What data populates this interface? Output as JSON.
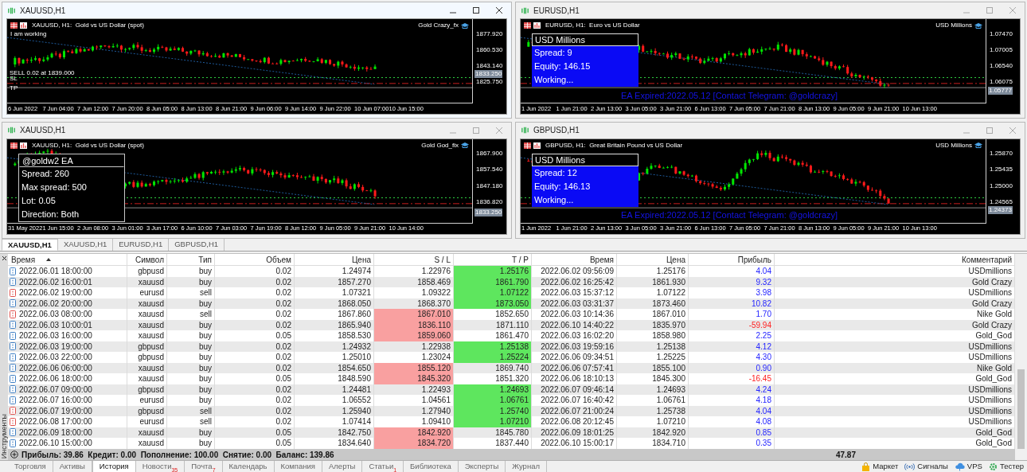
{
  "charts": [
    {
      "title": "XAUUSD,H1",
      "active": true,
      "header": "XAUUSD, H1:  Gold vs US Dollar (spot)",
      "ea_name": "Gold Crazy_fx",
      "status": "I am working",
      "price_labels": [
        "1877.920",
        "1860.530",
        "1843.140",
        "1825.750"
      ],
      "current_price": "1833.250",
      "time_labels": [
        "6 Jun 2022",
        "7 Jun 04:00",
        "7 Jun 12:00",
        "7 Jun 20:00",
        "8 Jun 05:00",
        "8 Jun 13:00",
        "8 Jun 21:00",
        "9 Jun 06:00",
        "9 Jun 14:00",
        "9 Jun 22:00",
        "10 Jun 07:00",
        "10 Jun 15:00"
      ],
      "level_labels": [
        "SELL 0.02 at 1839.000",
        "SL",
        "TP"
      ]
    },
    {
      "title": "EURUSD,H1",
      "active": false,
      "header": "EURUSD, H1:  Euro vs US Dollar",
      "ea_name": "USD Millions",
      "price_labels": [
        "1.07470",
        "1.07005",
        "1.06540",
        "1.06075"
      ],
      "current_price": "1.05777",
      "time_labels": [
        "1 Jun 2022",
        "1 Jun 21:00",
        "2 Jun 13:00",
        "3 Jun 05:00",
        "3 Jun 21:00",
        "6 Jun 13:00",
        "7 Jun 05:00",
        "7 Jun 21:00",
        "8 Jun 13:00",
        "9 Jun 05:00",
        "9 Jun 21:00",
        "10 Jun 13:00"
      ],
      "panel": {
        "kind": "blue",
        "title": "USD Millions",
        "lines": [
          "Spread: 9",
          "Equity: 146.15",
          "Working..."
        ]
      },
      "expired": "EA Expired:2022.05.12 [Contact Telegram: @goldcrazy]"
    },
    {
      "title": "XAUUSD,H1",
      "active": false,
      "header": "XAUUSD, H1:  Gold vs US Dollar (spot)",
      "ea_name": "Gold God_fix",
      "price_labels": [
        "1867.900",
        "1857.540",
        "1847.180",
        "1836.820"
      ],
      "current_price": "1833.250",
      "time_labels": [
        "31 May 2022",
        "1 Jun 15:00",
        "2 Jun 08:00",
        "3 Jun 01:00",
        "3 Jun 17:00",
        "6 Jun 10:00",
        "7 Jun 03:00",
        "7 Jun 19:00",
        "8 Jun 12:00",
        "9 Jun 05:00",
        "9 Jun 21:00",
        "10 Jun 14:00"
      ],
      "panel": {
        "kind": "dark",
        "title": "@goldw2 EA",
        "lines": [
          "Spread: 260",
          "Max spread: 500",
          "Lot: 0.05",
          "Direction: Both"
        ]
      }
    },
    {
      "title": "GBPUSD,H1",
      "active": false,
      "header": "GBPUSD, H1:  Great Britain Pound vs US Dollar",
      "ea_name": "USD Millions",
      "price_labels": [
        "1.25870",
        "1.25435",
        "1.25000",
        "1.24565"
      ],
      "current_price": "1.24373",
      "time_labels": [
        "1 Jun 2022",
        "1 Jun 21:00",
        "2 Jun 13:00",
        "3 Jun 05:00",
        "3 Jun 21:00",
        "6 Jun 13:00",
        "7 Jun 05:00",
        "7 Jun 21:00",
        "8 Jun 13:00",
        "9 Jun 05:00",
        "9 Jun 21:00",
        "10 Jun 13:00"
      ],
      "panel": {
        "kind": "blue",
        "title": "USD Millions",
        "lines": [
          "Spread: 12",
          "Equity: 146.13",
          "Working..."
        ]
      },
      "expired": "EA Expired:2022.05.12 [Contact Telegram: @goldcrazy]"
    }
  ],
  "chart_tabs": [
    {
      "label": "XAUUSD,H1",
      "selected": true
    },
    {
      "label": "XAUUSD,H1",
      "selected": false
    },
    {
      "label": "EURUSD,H1",
      "selected": false
    },
    {
      "label": "GBPUSD,H1",
      "selected": false
    }
  ],
  "toolbox_label": "Инструменты",
  "table": {
    "columns": [
      {
        "label": "Время",
        "sorted": true
      },
      {
        "label": "Символ",
        "sorted": false
      },
      {
        "label": "Тип",
        "sorted": false
      },
      {
        "label": "Объем",
        "sorted": false
      },
      {
        "label": "Цена",
        "sorted": false
      },
      {
        "label": "S / L",
        "sorted": false
      },
      {
        "label": "T / P",
        "sorted": false
      },
      {
        "label": "Время",
        "sorted": false
      },
      {
        "label": "Цена",
        "sorted": false
      },
      {
        "label": "Прибыль",
        "sorted": false
      },
      {
        "label": "Комментарий",
        "sorted": false
      }
    ],
    "rows": [
      {
        "open_time": "2022.06.01 18:00:00",
        "symbol": "gbpusd",
        "type": "buy",
        "volume": "0.02",
        "price": "1.24974",
        "sl": "1.22976",
        "tp": "1.25176",
        "close_time": "2022.06.02 09:56:09",
        "close_price": "1.25176",
        "profit": "4.04",
        "comment": "USDmillions",
        "sl_hit": false,
        "tp_hit": true,
        "color": "#3f7fc4",
        "loss": false
      },
      {
        "open_time": "2022.06.02 16:00:01",
        "symbol": "xauusd",
        "type": "buy",
        "volume": "0.02",
        "price": "1857.270",
        "sl": "1858.469",
        "tp": "1861.790",
        "close_time": "2022.06.02 16:25:42",
        "close_price": "1861.930",
        "profit": "9.32",
        "comment": "Gold Crazy",
        "sl_hit": false,
        "tp_hit": true,
        "color": "#3f7fc4",
        "loss": false
      },
      {
        "open_time": "2022.06.02 19:00:00",
        "symbol": "eurusd",
        "type": "sell",
        "volume": "0.02",
        "price": "1.07321",
        "sl": "1.09322",
        "tp": "1.07122",
        "close_time": "2022.06.03 15:37:12",
        "close_price": "1.07122",
        "profit": "3.98",
        "comment": "USDmillions",
        "sl_hit": false,
        "tp_hit": true,
        "color": "#e0504c",
        "loss": false
      },
      {
        "open_time": "2022.06.02 20:00:00",
        "symbol": "xauusd",
        "type": "buy",
        "volume": "0.02",
        "price": "1868.050",
        "sl": "1868.370",
        "tp": "1873.050",
        "close_time": "2022.06.03 03:31:37",
        "close_price": "1873.460",
        "profit": "10.82",
        "comment": "Gold Crazy",
        "sl_hit": false,
        "tp_hit": true,
        "color": "#3f7fc4",
        "loss": false
      },
      {
        "open_time": "2022.06.03 08:00:00",
        "symbol": "xauusd",
        "type": "sell",
        "volume": "0.02",
        "price": "1867.860",
        "sl": "1867.010",
        "tp": "1852.650",
        "close_time": "2022.06.03 10:14:36",
        "close_price": "1867.010",
        "profit": "1.70",
        "comment": "Nike Gold",
        "sl_hit": true,
        "tp_hit": false,
        "color": "#e0504c",
        "loss": false
      },
      {
        "open_time": "2022.06.03 10:00:01",
        "symbol": "xauusd",
        "type": "buy",
        "volume": "0.02",
        "price": "1865.940",
        "sl": "1836.110",
        "tp": "1871.110",
        "close_time": "2022.06.10 14:40:22",
        "close_price": "1835.970",
        "profit": "-59.94",
        "comment": "Gold Crazy",
        "sl_hit": true,
        "tp_hit": false,
        "color": "#3f7fc4",
        "loss": true
      },
      {
        "open_time": "2022.06.03 16:00:00",
        "symbol": "xauusd",
        "type": "buy",
        "volume": "0.05",
        "price": "1858.530",
        "sl": "1859.060",
        "tp": "1861.470",
        "close_time": "2022.06.03 16:02:20",
        "close_price": "1858.980",
        "profit": "2.25",
        "comment": "Gold_God",
        "sl_hit": true,
        "tp_hit": false,
        "color": "#3f7fc4",
        "loss": false
      },
      {
        "open_time": "2022.06.03 19:00:00",
        "symbol": "gbpusd",
        "type": "buy",
        "volume": "0.02",
        "price": "1.24932",
        "sl": "1.22938",
        "tp": "1.25138",
        "close_time": "2022.06.03 19:59:16",
        "close_price": "1.25138",
        "profit": "4.12",
        "comment": "USDmillions",
        "sl_hit": false,
        "tp_hit": true,
        "color": "#3f7fc4",
        "loss": false
      },
      {
        "open_time": "2022.06.03 22:00:00",
        "symbol": "gbpusd",
        "type": "buy",
        "volume": "0.02",
        "price": "1.25010",
        "sl": "1.23024",
        "tp": "1.25224",
        "close_time": "2022.06.06 09:34:51",
        "close_price": "1.25225",
        "profit": "4.30",
        "comment": "USDmillions",
        "sl_hit": false,
        "tp_hit": true,
        "color": "#3f7fc4",
        "loss": false
      },
      {
        "open_time": "2022.06.06 06:00:00",
        "symbol": "xauusd",
        "type": "buy",
        "volume": "0.02",
        "price": "1854.650",
        "sl": "1855.120",
        "tp": "1869.740",
        "close_time": "2022.06.06 07:57:41",
        "close_price": "1855.100",
        "profit": "0.90",
        "comment": "Nike Gold",
        "sl_hit": true,
        "tp_hit": false,
        "color": "#3f7fc4",
        "loss": false
      },
      {
        "open_time": "2022.06.06 18:00:00",
        "symbol": "xauusd",
        "type": "buy",
        "volume": "0.05",
        "price": "1848.590",
        "sl": "1845.320",
        "tp": "1851.320",
        "close_time": "2022.06.06 18:10:13",
        "close_price": "1845.300",
        "profit": "-16.45",
        "comment": "Gold_God",
        "sl_hit": true,
        "tp_hit": false,
        "color": "#3f7fc4",
        "loss": true
      },
      {
        "open_time": "2022.06.07 09:00:00",
        "symbol": "gbpusd",
        "type": "buy",
        "volume": "0.02",
        "price": "1.24481",
        "sl": "1.22493",
        "tp": "1.24693",
        "close_time": "2022.06.07 09:46:14",
        "close_price": "1.24693",
        "profit": "4.24",
        "comment": "USDmillions",
        "sl_hit": false,
        "tp_hit": true,
        "color": "#3f7fc4",
        "loss": false
      },
      {
        "open_time": "2022.06.07 16:00:00",
        "symbol": "eurusd",
        "type": "buy",
        "volume": "0.02",
        "price": "1.06552",
        "sl": "1.04561",
        "tp": "1.06761",
        "close_time": "2022.06.07 16:40:42",
        "close_price": "1.06761",
        "profit": "4.18",
        "comment": "USDmillions",
        "sl_hit": false,
        "tp_hit": true,
        "color": "#3f7fc4",
        "loss": false
      },
      {
        "open_time": "2022.06.07 19:00:00",
        "symbol": "gbpusd",
        "type": "sell",
        "volume": "0.02",
        "price": "1.25940",
        "sl": "1.27940",
        "tp": "1.25740",
        "close_time": "2022.06.07 21:00:24",
        "close_price": "1.25738",
        "profit": "4.04",
        "comment": "USDmillions",
        "sl_hit": false,
        "tp_hit": true,
        "color": "#e0504c",
        "loss": false
      },
      {
        "open_time": "2022.06.08 17:00:00",
        "symbol": "eurusd",
        "type": "sell",
        "volume": "0.02",
        "price": "1.07414",
        "sl": "1.09410",
        "tp": "1.07210",
        "close_time": "2022.06.08 20:12:45",
        "close_price": "1.07210",
        "profit": "4.08",
        "comment": "USDmillions",
        "sl_hit": false,
        "tp_hit": true,
        "color": "#e0504c",
        "loss": false
      },
      {
        "open_time": "2022.06.09 18:00:00",
        "symbol": "xauusd",
        "type": "buy",
        "volume": "0.05",
        "price": "1842.750",
        "sl": "1842.920",
        "tp": "1845.780",
        "close_time": "2022.06.09 18:01:25",
        "close_price": "1842.920",
        "profit": "0.85",
        "comment": "Gold_God",
        "sl_hit": true,
        "tp_hit": false,
        "color": "#3f7fc4",
        "loss": false
      },
      {
        "open_time": "2022.06.10 15:00:00",
        "symbol": "xauusd",
        "type": "buy",
        "volume": "0.05",
        "price": "1834.640",
        "sl": "1834.720",
        "tp": "1837.440",
        "close_time": "2022.06.10 15:00:17",
        "close_price": "1834.710",
        "profit": "0.35",
        "comment": "Gold_God",
        "sl_hit": true,
        "tp_hit": false,
        "color": "#3f7fc4",
        "loss": false
      }
    ],
    "summary": {
      "text": "Прибыль: 39.86  Кредит: 0.00  Пополнение: 100.00  Снятие: 0.00  Баланс: 139.86",
      "total_profit": "47.87"
    }
  },
  "bottom_tabs": [
    {
      "label": "Торговля",
      "selected": false
    },
    {
      "label": "Активы",
      "selected": false
    },
    {
      "label": "История",
      "selected": true
    },
    {
      "label": "Новости",
      "badge": "35",
      "selected": false
    },
    {
      "label": "Почта",
      "badge": "7",
      "selected": false
    },
    {
      "label": "Календарь",
      "selected": false
    },
    {
      "label": "Компания",
      "selected": false
    },
    {
      "label": "Алерты",
      "selected": false
    },
    {
      "label": "Статьи",
      "badge": "1",
      "selected": false
    },
    {
      "label": "Библиотека",
      "selected": false
    },
    {
      "label": "Эксперты",
      "selected": false
    },
    {
      "label": "Журнал",
      "selected": false
    }
  ],
  "services": [
    {
      "kind": "market",
      "label": "Маркет"
    },
    {
      "kind": "signals",
      "label": "Сигналы"
    },
    {
      "kind": "vps",
      "label": "VPS"
    },
    {
      "kind": "tester",
      "label": "Тестер"
    }
  ]
}
